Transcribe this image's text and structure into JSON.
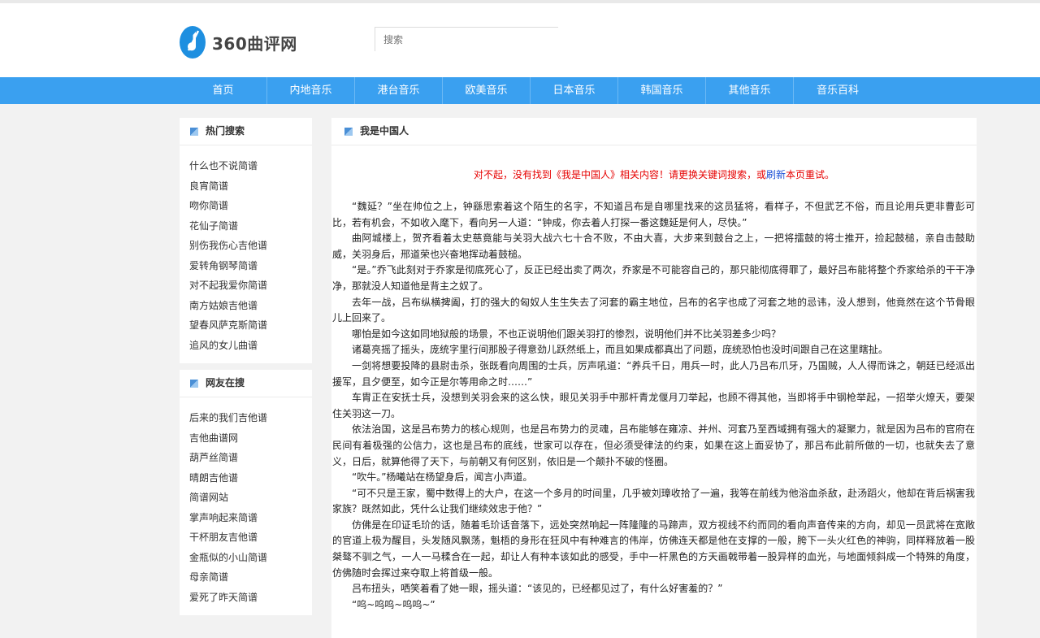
{
  "header": {
    "logo_text": "360曲评网",
    "search_placeholder": "搜索"
  },
  "nav": [
    "首页",
    "内地音乐",
    "港台音乐",
    "欧美音乐",
    "日本音乐",
    "韩国音乐",
    "其他音乐",
    "音乐百科"
  ],
  "sidebar": {
    "hot": {
      "title": "热门搜索",
      "items": [
        "什么也不说简谱",
        "良宵简谱",
        "吻你简谱",
        "花仙子简谱",
        "别伤我伤心吉他谱",
        "爱转角钢琴简谱",
        "对不起我爱你简谱",
        "南方姑娘吉他谱",
        "望春风萨克斯简谱",
        "追风的女儿曲谱"
      ]
    },
    "friends": {
      "title": "网友在搜",
      "items": [
        "后来的我们吉他谱",
        "吉他曲谱网",
        "葫芦丝简谱",
        "晴朗吉他谱",
        "简谱网站",
        "掌声响起来简谱",
        "干杯朋友吉他谱",
        "金瓶似的小山简谱",
        "母亲简谱",
        "爱死了昨天简谱"
      ]
    }
  },
  "main": {
    "title": "我是中国人",
    "notice_before": "对不起，没有找到《我是中国人》相关内容！请更换关键词搜索，或",
    "notice_link": "刷新",
    "notice_after": "本页重试。",
    "paragraphs": [
      "“魏延？”坐在帅位之上，钟繇思索着这个陌生的名字，不知道吕布是自哪里找来的这员猛将，看样子，不但武艺不俗，而且论用兵更非曹彭可比，若有机会，不如收入麾下，看向另一人道：“钟成，你去着人打探一番这魏延是何人，尽快。”",
      "曲阿城楼上，贺齐看着太史慈竟能与关羽大战六七十合不败，不由大喜，大步来到鼓台之上，一把将擂鼓的将士推开，捡起鼓槌，亲自击鼓助威，关羽身后，邢道荣也兴奋地挥动着鼓槌。",
      "“是。”乔飞此刻对于乔家是彻底死心了，反正已经出卖了两次，乔家是不可能容自己的，那只能彻底得罪了，最好吕布能将整个乔家给杀的干干净净，那就没人知道他是背主之奴了。",
      "去年一战，吕布纵横捭阖，打的强大的匈奴人生生失去了河套的霸主地位，吕布的名字也成了河套之地的忌讳，没人想到，他竟然在这个节骨眼儿上回来了。",
      "哪怕是如今这如同地狱般的场景，不也正说明他们跟关羽打的惨烈，说明他们并不比关羽差多少吗？",
      "诸葛亮摇了摇头，庞统字里行间那股子得意劲儿跃然纸上，而且如果成都真出了问题，庞统恐怕也没时间跟自己在这里瞎扯。",
      "一剑将想要投降的县尉击杀，张既看向周围的士兵，厉声吼道：“养兵千日，用兵一时，此人乃吕布爪牙，乃国贼，人人得而诛之，朝廷已经派出援军，且夕便至，如今正是尔等用命之时……”",
      "车胄正在安抚士兵，没想到关羽会来的这么快，眼见关羽手中那杆青龙偃月刀举起，也顾不得其他，当即将手中钢枪举起，一招举火燎天，要架住关羽这一刀。",
      "依法治国，这是吕布势力的核心规则，也是吕布势力的灵魂，吕布能够在雍凉、并州、河套乃至西域拥有强大的凝聚力，就是因为吕布的官府在民间有着极强的公信力，这也是吕布的底线，世家可以存在，但必须受律法的约束，如果在这上面妥协了，那吕布此前所做的一切，也就失去了意义，日后，就算他得了天下，与前朝又有何区别，依旧是一个颠扑不破的怪圈。",
      "“吹牛。”杨曦站在杨望身后，闻言小声道。",
      "“可不只是王家，蜀中数得上的大户，在这一个多月的时间里，几乎被刘璋收拾了一遍，我等在前线为他浴血杀敌，赴汤蹈火，他却在背后祸害我家族？既然如此，凭什么让我们继续效忠于他？”",
      "仿佛是在印证毛玠的话，随着毛玠话音落下，远处突然响起一阵隆隆的马蹄声，双方视线不约而同的看向声音传来的方向，却见一员武将在宽敞的官道上极为醒目，头发随风飘荡，魁梧的身形在狂风中有种难言的伟岸，仿佛连天都是他在支撑的一般，胯下一头火红色的神驹，同样释放着一股桀骜不驯之气，一人一马糅合在一起，却让人有种本该如此的感受，手中一杆黑色的方天画戟带着一股异样的血光，与地面倾斜成一个特殊的角度，仿佛随时会挥过来夺取上将首级一般。",
      "吕布扭头，哂笑着看了她一眼，摇头道：“该见的，已经都见过了，有什么好害羞的？”",
      "“呜~呜呜~呜呜~”"
    ]
  },
  "colors": {
    "nav_bg": "#3aa0f0",
    "notice": "#e60000",
    "link": "#1a4fd6"
  }
}
